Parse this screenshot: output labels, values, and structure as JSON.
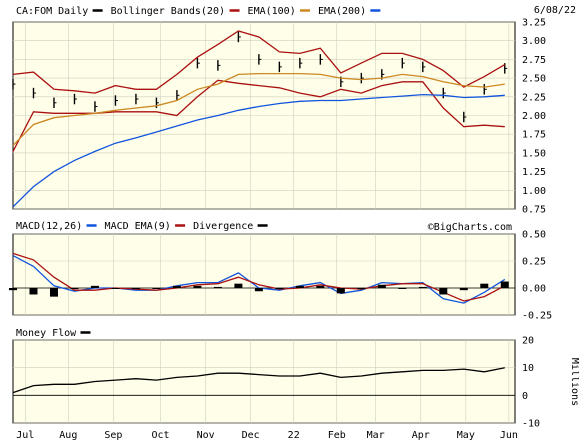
{
  "chart_data": [
    {
      "type": "ohlc",
      "panel": "price",
      "title": "CA:FOM Daily",
      "date": "6/08/22",
      "legend": [
        {
          "label": "CA:FOM Daily",
          "color": "#000000"
        },
        {
          "label": "Bollinger Bands(20)",
          "color": "#aa1111"
        },
        {
          "label": "EMA(100)",
          "color": "#cc8822"
        },
        {
          "label": "EMA(200)",
          "color": "#1155dd"
        }
      ],
      "ylim": [
        0.75,
        3.25
      ],
      "yticks": [
        "3.25",
        "3.00",
        "2.75",
        "2.50",
        "2.25",
        "2.00",
        "1.75",
        "1.50",
        "1.25",
        "1.00",
        "0.75"
      ],
      "x": [
        0,
        10,
        20,
        30,
        40,
        50,
        60,
        70,
        80,
        90,
        100,
        110,
        120,
        130,
        140,
        150,
        160,
        170,
        180,
        190,
        200,
        210,
        220,
        230,
        240
      ],
      "series": [
        {
          "name": "CA:FOM Daily",
          "values": [
            2.42,
            2.3,
            2.17,
            2.22,
            2.12,
            2.2,
            2.22,
            2.17,
            2.27,
            2.7,
            2.67,
            3.05,
            2.75,
            2.65,
            2.7,
            2.75,
            2.45,
            2.5,
            2.55,
            2.7,
            2.65,
            2.3,
            1.98,
            2.35,
            2.63
          ],
          "color": "#000000"
        },
        {
          "name": "Bollinger Bands(20) upper",
          "values": [
            2.55,
            2.58,
            2.35,
            2.33,
            2.3,
            2.4,
            2.35,
            2.35,
            2.55,
            2.78,
            2.95,
            3.13,
            3.05,
            2.85,
            2.83,
            2.9,
            2.57,
            2.7,
            2.83,
            2.83,
            2.75,
            2.6,
            2.38,
            2.52,
            2.68
          ],
          "color": "#aa1111"
        },
        {
          "name": "Bollinger Bands(20) lower",
          "values": [
            1.52,
            2.05,
            2.03,
            2.03,
            2.03,
            2.05,
            2.05,
            2.05,
            2.0,
            2.25,
            2.47,
            2.43,
            2.4,
            2.37,
            2.3,
            2.25,
            2.35,
            2.3,
            2.4,
            2.45,
            2.45,
            2.1,
            1.85,
            1.87,
            1.85
          ],
          "color": "#aa1111"
        },
        {
          "name": "EMA(100)",
          "values": [
            1.6,
            1.88,
            1.97,
            2.0,
            2.03,
            2.07,
            2.1,
            2.13,
            2.2,
            2.35,
            2.42,
            2.55,
            2.56,
            2.56,
            2.56,
            2.55,
            2.5,
            2.48,
            2.5,
            2.55,
            2.52,
            2.45,
            2.4,
            2.38,
            2.42
          ],
          "color": "#cc8822"
        },
        {
          "name": "EMA(200)",
          "values": [
            0.78,
            1.05,
            1.25,
            1.4,
            1.52,
            1.63,
            1.7,
            1.78,
            1.86,
            1.94,
            2.0,
            2.07,
            2.12,
            2.16,
            2.19,
            2.2,
            2.2,
            2.22,
            2.24,
            2.26,
            2.28,
            2.27,
            2.24,
            2.25,
            2.27
          ],
          "color": "#1155dd"
        }
      ]
    },
    {
      "type": "line",
      "panel": "macd",
      "legend": [
        {
          "label": "MACD(12,26)",
          "color": "#1155dd"
        },
        {
          "label": "MACD EMA(9)",
          "color": "#aa1111"
        },
        {
          "label": "Divergence",
          "color": "#000000"
        }
      ],
      "ylim": [
        -0.25,
        0.5
      ],
      "yticks": [
        "0.50",
        "0.25",
        "0.00",
        "-0.25"
      ],
      "x": [
        0,
        10,
        20,
        30,
        40,
        50,
        60,
        70,
        80,
        90,
        100,
        110,
        120,
        130,
        140,
        150,
        160,
        170,
        180,
        190,
        200,
        210,
        220,
        230,
        240
      ],
      "series": [
        {
          "name": "MACD(12,26)",
          "values": [
            0.3,
            0.2,
            0.02,
            -0.03,
            0.0,
            0.0,
            -0.02,
            -0.02,
            0.02,
            0.05,
            0.05,
            0.14,
            0.0,
            -0.02,
            0.02,
            0.05,
            -0.05,
            -0.02,
            0.05,
            0.04,
            0.05,
            -0.1,
            -0.14,
            -0.04,
            0.08
          ],
          "color": "#1155dd"
        },
        {
          "name": "MACD EMA(9)",
          "values": [
            0.32,
            0.26,
            0.1,
            -0.02,
            -0.02,
            0.0,
            -0.01,
            -0.02,
            0.0,
            0.03,
            0.04,
            0.1,
            0.03,
            -0.01,
            0.0,
            0.03,
            0.0,
            -0.01,
            0.02,
            0.04,
            0.04,
            -0.04,
            -0.12,
            -0.08,
            0.02
          ],
          "color": "#aa1111"
        },
        {
          "name": "Divergence",
          "values": [
            -0.02,
            -0.06,
            -0.08,
            -0.01,
            0.02,
            0.0,
            -0.01,
            0.0,
            0.02,
            0.02,
            0.01,
            0.04,
            -0.03,
            -0.01,
            0.02,
            0.02,
            -0.05,
            -0.01,
            0.03,
            0.0,
            0.01,
            -0.06,
            -0.02,
            0.04,
            0.06
          ],
          "color": "#000000"
        }
      ]
    },
    {
      "type": "line",
      "panel": "money_flow",
      "legend": [
        {
          "label": "Money Flow",
          "color": "#000000"
        }
      ],
      "ylim": [
        -10,
        20
      ],
      "yticks": [
        "20",
        "10",
        "0",
        "-10"
      ],
      "ylabel": "Millions",
      "x": [
        0,
        10,
        20,
        30,
        40,
        50,
        60,
        70,
        80,
        90,
        100,
        110,
        120,
        130,
        140,
        150,
        160,
        170,
        180,
        190,
        200,
        210,
        220,
        230,
        240
      ],
      "series": [
        {
          "name": "Money Flow",
          "values": [
            1.0,
            3.5,
            4.0,
            4.0,
            5.0,
            5.5,
            6.0,
            5.5,
            6.5,
            7.0,
            8.0,
            8.0,
            7.5,
            7.0,
            7.0,
            8.0,
            6.5,
            7.0,
            8.0,
            8.5,
            9.0,
            9.0,
            9.5,
            8.5,
            10.0
          ],
          "color": "#000000"
        }
      ]
    }
  ],
  "xaxis": {
    "ticks": [
      {
        "label": "Jul",
        "x": 6
      },
      {
        "label": "Aug",
        "x": 27
      },
      {
        "label": "Sep",
        "x": 49
      },
      {
        "label": "Oct",
        "x": 72
      },
      {
        "label": "Nov",
        "x": 94
      },
      {
        "label": "Dec",
        "x": 116
      },
      {
        "label": "22",
        "x": 137
      },
      {
        "label": "Feb",
        "x": 158
      },
      {
        "label": "Mar",
        "x": 177
      },
      {
        "label": "Apr",
        "x": 199
      },
      {
        "label": "May",
        "x": 221
      },
      {
        "label": "Jun",
        "x": 242
      }
    ]
  },
  "watermark": "©BigCharts.com",
  "colors": {
    "panel_bg": "#fffee8",
    "grid": "#cfcfbf",
    "price": "#000000",
    "bollinger": "#aa1111",
    "ema100": "#cc8822",
    "ema200": "#1155dd"
  }
}
